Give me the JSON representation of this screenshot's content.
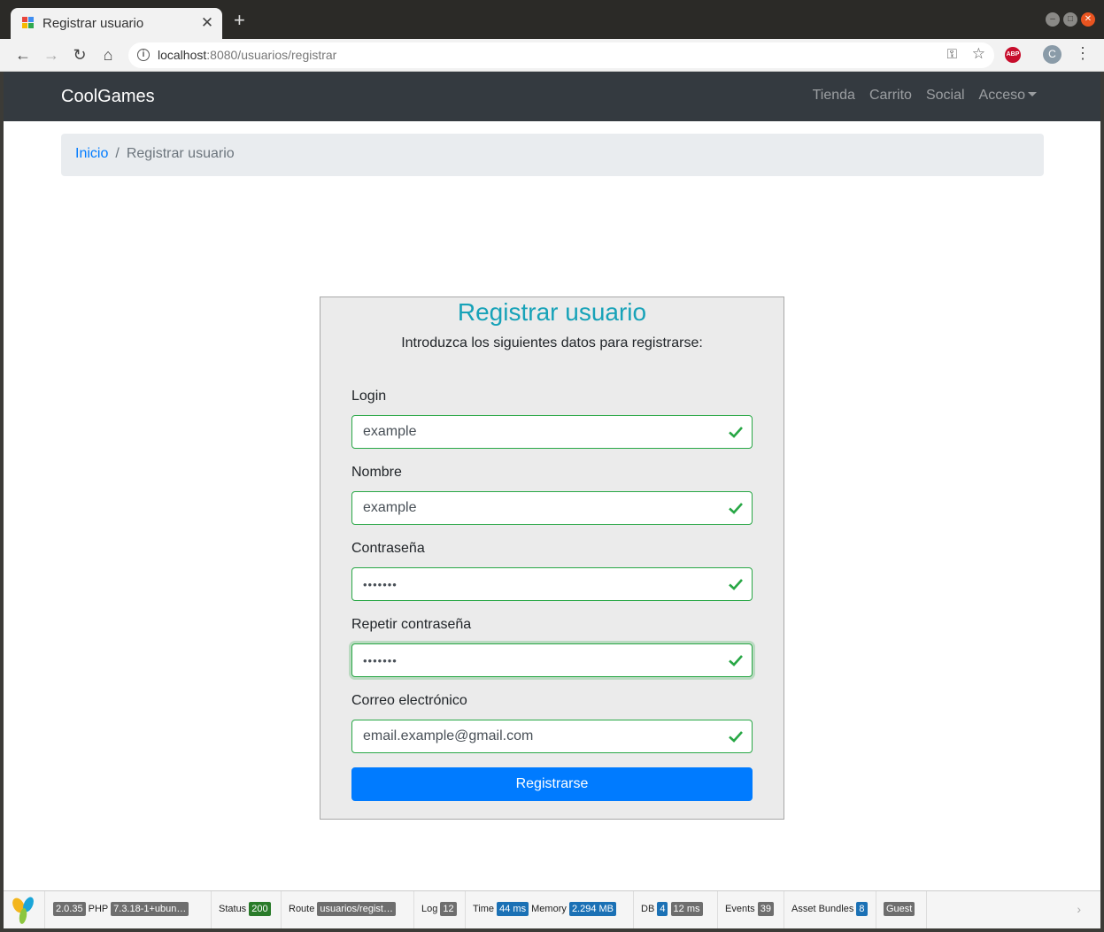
{
  "browser": {
    "tab_title": "Registrar usuario",
    "new_tab": "+",
    "url_host": "localhost",
    "url_rest": ":8080/usuarios/registrar"
  },
  "site": {
    "brand": "CoolGames",
    "nav": [
      "Tienda",
      "Carrito",
      "Social",
      "Acceso"
    ]
  },
  "breadcrumb": {
    "home": "Inicio",
    "separator": "/",
    "current": "Registrar usuario"
  },
  "form": {
    "title": "Registrar usuario",
    "subtitle": "Introduzca los siguientes datos para registrarse:",
    "fields": [
      {
        "label": "Login",
        "value": "example",
        "type": "text"
      },
      {
        "label": "Nombre",
        "value": "example",
        "type": "text"
      },
      {
        "label": "Contraseña",
        "value": "•••••••",
        "type": "password"
      },
      {
        "label": "Repetir contraseña",
        "value": "•••••••",
        "type": "password"
      },
      {
        "label": "Correo electrónico",
        "value": "email.example@gmail.com",
        "type": "text"
      }
    ],
    "submit_label": "Registrarse"
  },
  "debug": {
    "version": "2.0.35",
    "php_label": "PHP",
    "php_version": "7.3.18-1+ubun…",
    "status_label": "Status",
    "status": "200",
    "route_label": "Route",
    "route": "usuarios/regist…",
    "log_label": "Log",
    "log": "12",
    "time_label": "Time",
    "time": "44 ms",
    "memory_label": "Memory",
    "memory": "2.294 MB",
    "db_label": "DB",
    "db_count": "4",
    "db_time": "12 ms",
    "events_label": "Events",
    "events": "39",
    "assets_label": "Asset Bundles",
    "assets": "8",
    "user": "Guest"
  },
  "colors": {
    "navbar": "#343a40",
    "accent_title": "#17a2b8",
    "valid": "#28a745",
    "primary": "#007bff"
  }
}
